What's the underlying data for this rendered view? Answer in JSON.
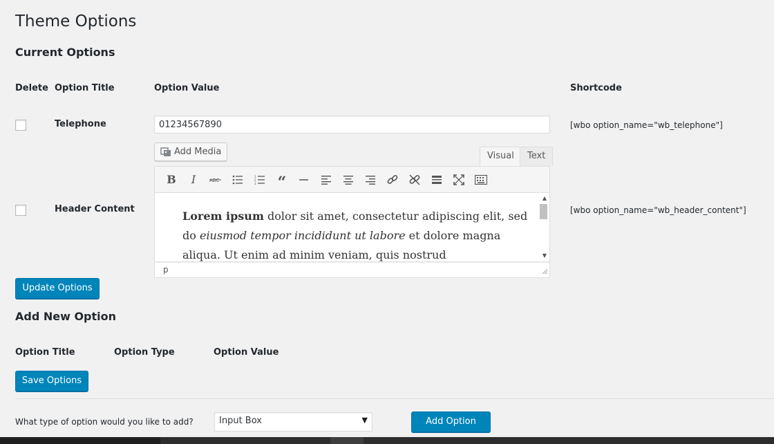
{
  "page_title": "Theme Options",
  "current_options": {
    "section_title": "Current Options",
    "columns": {
      "delete": "Delete",
      "option_title": "Option Title",
      "option_value": "Option Value",
      "shortcode": "Shortcode"
    },
    "rows": [
      {
        "title": "Telephone",
        "value": "01234567890",
        "shortcode": "[wbo option_name=\"wb_telephone\"]"
      },
      {
        "title": "Header Content",
        "shortcode": "[wbo option_name=\"wb_header_content\"]",
        "editor": {
          "add_media_label": "Add Media",
          "tabs": [
            "Visual",
            "Text"
          ],
          "active_tab": "Visual",
          "toolbar_icons": [
            "bold-icon",
            "italic-icon",
            "strikethrough-icon",
            "bullet-list-icon",
            "numbered-list-icon",
            "blockquote-icon",
            "horizontal-rule-icon",
            "align-left-icon",
            "align-center-icon",
            "align-right-icon",
            "insert-link-icon",
            "remove-link-icon",
            "read-more-icon",
            "fullscreen-icon",
            "toolbar-toggle-icon"
          ],
          "content": {
            "bold": "Lorem ipsum",
            "t1": " dolor sit amet, consectetur adipiscing elit, sed do ",
            "italic": "eiusmod tempor incididunt ut labore",
            "t2": " et dolore magna aliqua. Ut enim ad minim veniam, quis nostrud"
          },
          "status_path": "p"
        }
      }
    ],
    "update_button": "Update Options"
  },
  "add_new_option": {
    "section_title": "Add New Option",
    "columns": {
      "option_title": "Option Title",
      "option_type": "Option Type",
      "option_value": "Option Value"
    },
    "save_button": "Save Options",
    "type_prompt": "What type of option would you like to add?",
    "type_selected": "Input Box",
    "add_button": "Add Option"
  },
  "colors": {
    "primary_button": "#0085ba",
    "background": "#f1f1f1"
  }
}
